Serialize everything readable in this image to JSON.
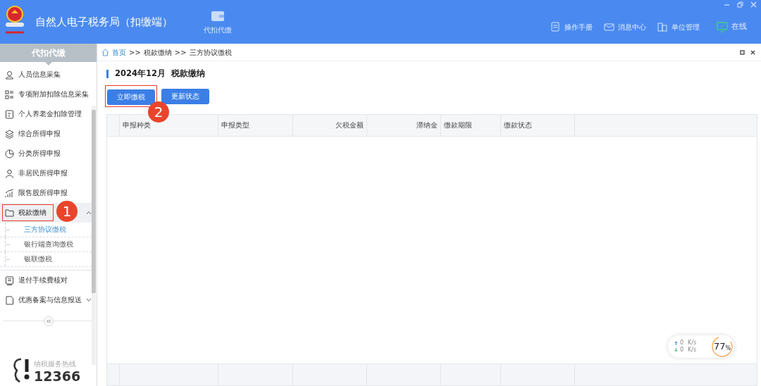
{
  "header": {
    "title": "自然人电子税务局（扣缴端）",
    "module": "代扣代缴",
    "actions": [
      {
        "label": "操作手册"
      },
      {
        "label": "消息中心"
      },
      {
        "label": "单位管理"
      },
      {
        "label": "在线"
      }
    ]
  },
  "sidebar": {
    "title": "代扣代缴",
    "items": [
      {
        "label": "人员信息采集",
        "selected": false
      },
      {
        "label": "专项附加扣除信息采集",
        "selected": false
      },
      {
        "label": "个人养老金扣除管理",
        "selected": false
      },
      {
        "label": "综合所得申报",
        "selected": false
      },
      {
        "label": "分类所得申报",
        "selected": false
      },
      {
        "label": "非居民所得申报",
        "selected": false
      },
      {
        "label": "限售股所得申报",
        "selected": false
      },
      {
        "label": "税款缴纳",
        "selected": true,
        "expanded": true,
        "annotation": "1",
        "children": [
          {
            "label": "三方协议缴税",
            "selected": true
          },
          {
            "label": "银行端查询缴税",
            "selected": false
          },
          {
            "label": "银联缴税",
            "selected": false
          }
        ]
      },
      {
        "label": "退付手续费核对",
        "selected": false
      },
      {
        "label": "优惠备案与信息报送",
        "selected": false,
        "expanded": false
      }
    ],
    "hotline_label": "纳税服务热线",
    "hotline_number": "12366"
  },
  "breadcrumb": [
    "首页",
    ">>",
    "税款缴纳",
    ">>",
    "三方协议缴税"
  ],
  "page_title": "2024年12月  税款缴纳",
  "buttons": [
    {
      "label": "立即缴税",
      "annotation": "2"
    },
    {
      "label": "更新状态"
    }
  ],
  "table": {
    "columns": [
      {
        "label": "申报种类",
        "numeric": false
      },
      {
        "label": "申报类型",
        "numeric": false
      },
      {
        "label": "欠税金额",
        "numeric": true
      },
      {
        "label": "滞纳金",
        "numeric": true
      },
      {
        "label": "缴款期限",
        "numeric": false
      },
      {
        "label": "缴款状态",
        "numeric": false
      }
    ]
  },
  "monitor": {
    "upload": "0",
    "download": "0",
    "unit_up": "K/s",
    "unit_down": "K/s",
    "percent": "77",
    "percent_sign": "%",
    "level": 0.77
  }
}
